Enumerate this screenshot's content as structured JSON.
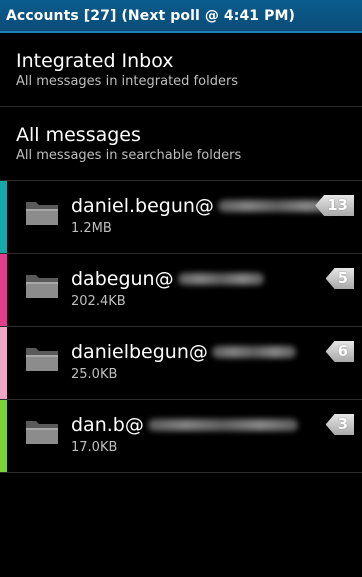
{
  "title_bar": {
    "title": "Accounts [27] (Next poll @ 4:41 PM)"
  },
  "folders": [
    {
      "name": "Integrated Inbox",
      "description": "All messages in integrated folders"
    },
    {
      "name": "All messages",
      "description": "All messages in searchable folders"
    }
  ],
  "accounts": [
    {
      "email": "daniel.begun@",
      "size": "1.2MB",
      "unread": "13",
      "color": "#1aa7a7"
    },
    {
      "email": "dabegun@",
      "size": "202.4KB",
      "unread": "5",
      "color": "#e23c8e"
    },
    {
      "email": "danielbegun@",
      "size": "25.0KB",
      "unread": "6",
      "color": "#f0a4c6"
    },
    {
      "email": "dan.b@",
      "size": "17.0KB",
      "unread": "3",
      "color": "#7bd13a"
    }
  ]
}
